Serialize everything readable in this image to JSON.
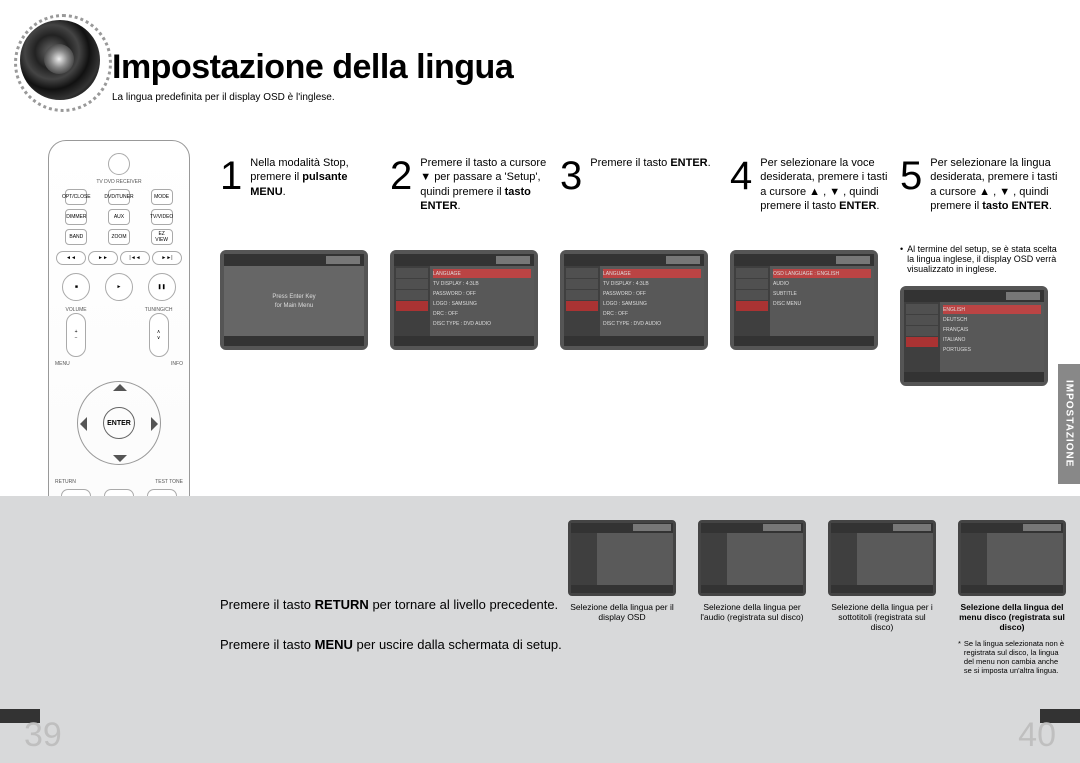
{
  "title": "Impostazione della lingua",
  "subtitle": "La lingua predefinita per il display OSD è l'inglese.",
  "remote_enter_label": "ENTER",
  "steps": [
    {
      "num": "1",
      "text_html": "Nella modalità Stop, premere il pulsante MENU.",
      "text": "Nella modalità Stop, premere il ",
      "bold": "pulsante MENU",
      "after": "."
    },
    {
      "num": "2",
      "text": "Premere il tasto a cursore ▼ per passare a 'Setup', quindi premere il ",
      "bold": "tasto ENTER",
      "after": "."
    },
    {
      "num": "3",
      "text": "Premere il tasto ",
      "bold": "ENTER",
      "after": "."
    },
    {
      "num": "4",
      "text": "Per selezionare la voce desiderata, premere i tasti a cursore ▲ , ▼ , quindi premere il tasto ",
      "bold": "ENTER",
      "after": "."
    },
    {
      "num": "5",
      "text": "Per selezionare la lingua desiderata, premere i tasti a cursore ▲ , ▼ , quindi premere il ",
      "bold": "tasto ENTER",
      "after": "."
    }
  ],
  "step5_note": "Al termine del setup, se è stata scelta la lingua inglese, il display OSD verrà visualizzato in inglese.",
  "sidetab": "IMPOSTAZIONE",
  "bottom_notes": [
    {
      "pre": "Premere il tasto ",
      "bold": "RETURN",
      "post": " per tornare al livello precedente."
    },
    {
      "pre": "Premere il tasto ",
      "bold": "MENU",
      "post": " per uscire dalla schermata di setup."
    }
  ],
  "mini": [
    {
      "cap": "Selezione della lingua per il display OSD",
      "bold": false
    },
    {
      "cap": "Selezione della lingua per l'audio (registrata sul disco)",
      "bold": false
    },
    {
      "cap": "Selezione della lingua per i sottotitoli (registrata sul disco)",
      "bold": false
    },
    {
      "cap": "Selezione della lingua del menu disco (registrata sul disco)",
      "bold": true,
      "footnote": "Se la lingua selezionata non è registrata sul disco, la lingua del menu non cambia anche se si imposta un'altra lingua."
    }
  ],
  "page_left": "39",
  "page_right": "40",
  "screen1": {
    "line1": "Press Enter Key",
    "line2": "for Main Menu"
  },
  "screen_menu": [
    "LANGUAGE",
    "TV DISPLAY",
    "PASSWORD",
    "LOGO",
    "DRC",
    "DISC TYPE"
  ],
  "screen_vals": [
    "4:3LB",
    "OFF",
    "SAMSUNG",
    "OFF",
    "DVD AUDIO"
  ],
  "screen4": [
    "OSD LANGUAGE : ENGLISH",
    "AUDIO",
    "SUBTITLE",
    "DISC MENU"
  ],
  "screen5": [
    "ENGLISH",
    "DEUTSCH",
    "FRANÇAIS",
    "ITALIANO",
    "PORTUGES"
  ]
}
